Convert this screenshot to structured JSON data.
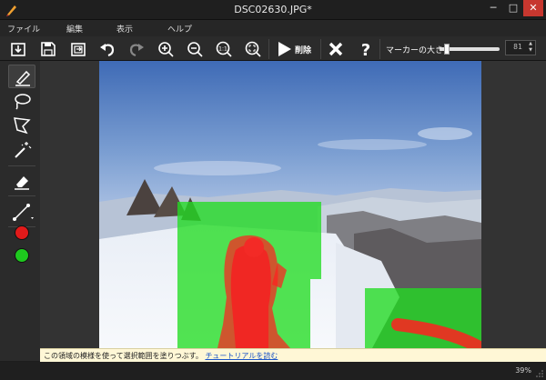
{
  "window": {
    "title": "DSC02630.JPG*",
    "min_glyph": "─",
    "max_glyph": "□",
    "close_glyph": "✕"
  },
  "menu": [
    "ファイル",
    "編集",
    "表示",
    "ヘルプ"
  ],
  "toolbar": {
    "buttons": [
      "open-icon",
      "save-icon",
      "export-icon",
      "undo-icon",
      "redo-icon",
      "zoom-in-icon",
      "zoom-out-icon",
      "zoom-1to1-icon",
      "zoom-fit-icon",
      "play-icon",
      "cancel-x-icon",
      "help-icon"
    ],
    "erase_label": "削除",
    "marker_size_label": "マーカーの大きさ",
    "marker_size_value": "81",
    "marker_size_fraction": 0.08
  },
  "tools": [
    "marker-icon",
    "lasso-icon",
    "polygon-lasso-icon",
    "magic-wand-icon",
    "eraser-icon",
    "line-icon"
  ],
  "colors": {
    "remove": "#e11a1a",
    "keep": "#1ec81e",
    "red_overlay": "#ff2020",
    "green_overlay": "#22dd22"
  },
  "tip": {
    "text": "この領域の模様を使って選択範囲を塗りつぶす。",
    "link": "チュートリアルを読む"
  },
  "status": {
    "zoom": "39%"
  }
}
